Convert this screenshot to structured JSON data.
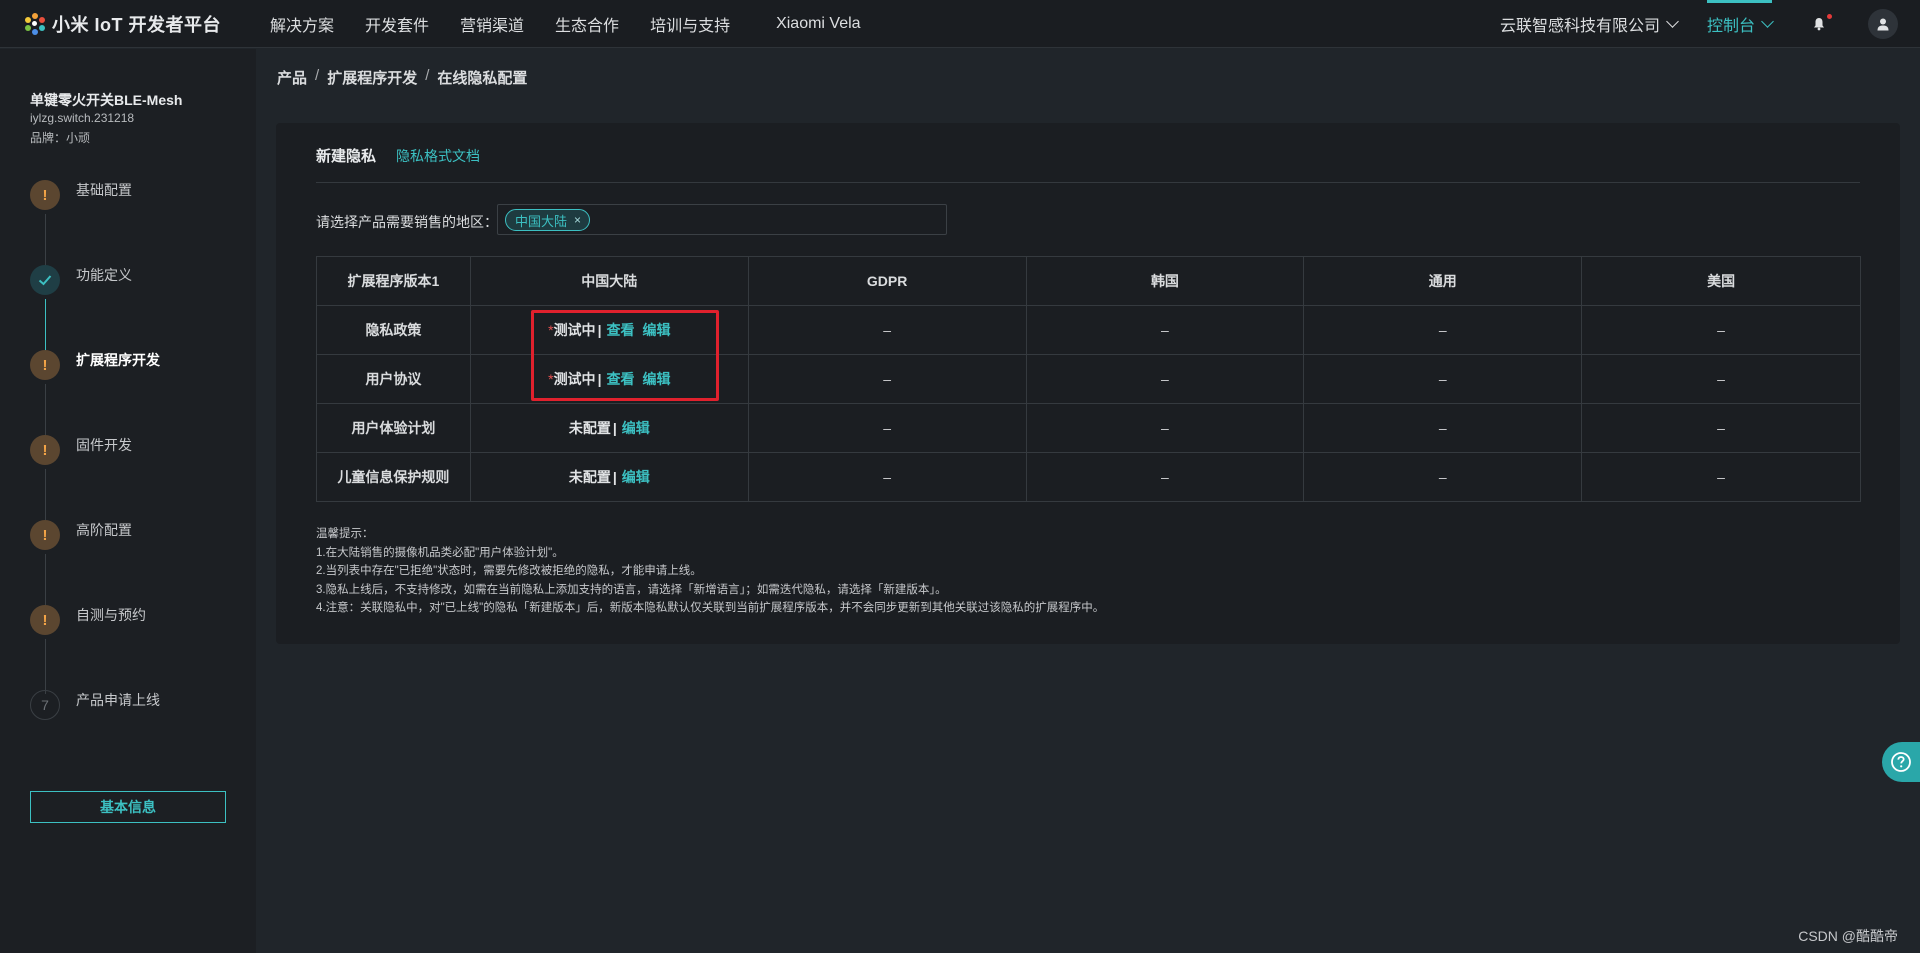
{
  "brand": {
    "logo_text": "小米 IoT 开发者平台"
  },
  "topnav": {
    "items": [
      "解决方案",
      "开发套件",
      "营销渠道",
      "生态合作",
      "培训与支持",
      "Xiaomi Vela"
    ],
    "company": "云联智感科技有限公司",
    "console": "控制台",
    "accent_color": "#3cc0c2"
  },
  "product": {
    "name": "单键零火开关BLE-Mesh",
    "model": "iylzg.switch.231218",
    "brand": "品牌：小顽"
  },
  "steps": [
    {
      "label": "基础配置",
      "state": "warning",
      "icon": "!"
    },
    {
      "label": "功能定义",
      "state": "done",
      "icon": "check-icon"
    },
    {
      "label": "扩展程序开发",
      "state": "active-warning",
      "icon": "!"
    },
    {
      "label": "固件开发",
      "state": "warning",
      "icon": "!"
    },
    {
      "label": "高阶配置",
      "state": "warning",
      "icon": "!"
    },
    {
      "label": "自测与预约",
      "state": "warning",
      "icon": "!"
    },
    {
      "label": "产品申请上线",
      "state": "pending",
      "icon": "7"
    }
  ],
  "sidebar": {
    "basic_info_button": "基本信息"
  },
  "breadcrumb": [
    "产品",
    "扩展程序开发",
    "在线隐私配置"
  ],
  "card": {
    "title": "新建隐私",
    "doc_link": "隐私格式文档",
    "region_label": "请选择产品需要销售的地区：",
    "region_tags": [
      {
        "label": "中国大陆",
        "close": "×"
      }
    ]
  },
  "table": {
    "headers": [
      "扩展程序版本1",
      "中国大陆",
      "GDPR",
      "韩国",
      "通用",
      "美国"
    ],
    "rows": [
      {
        "name": "隐私政策",
        "star": "*",
        "status": "测试中",
        "sep": "|",
        "actions": [
          "查看",
          "编辑"
        ],
        "others": [
          "–",
          "–",
          "–",
          "–"
        ]
      },
      {
        "name": "用户协议",
        "star": "*",
        "status": "测试中",
        "sep": "|",
        "actions": [
          "查看",
          "编辑"
        ],
        "others": [
          "–",
          "–",
          "–",
          "–"
        ]
      },
      {
        "name": "用户体验计划",
        "star": "",
        "status": "未配置",
        "sep": "|",
        "actions": [
          "编辑"
        ],
        "others": [
          "–",
          "–",
          "–",
          "–"
        ]
      },
      {
        "name": "儿童信息保护规则",
        "star": "",
        "status": "未配置",
        "sep": "|",
        "actions": [
          "编辑"
        ],
        "others": [
          "–",
          "–",
          "–",
          "–"
        ]
      }
    ]
  },
  "tips": {
    "title": "温馨提示：",
    "lines": [
      "1.在大陆销售的摄像机品类必配\"用户体验计划\"。",
      "2.当列表中存在\"已拒绝\"状态时，需要先修改被拒绝的隐私，才能申请上线。",
      "3.隐私上线后，不支持修改，如需在当前隐私上添加支持的语言，请选择「新增语言」；如需迭代隐私，请选择「新建版本」。",
      "4.注意：关联隐私中，对\"已上线\"的隐私「新建版本」后，新版本隐私默认仅关联到当前扩展程序版本，并不会同步更新到其他关联过该隐私的扩展程序中。"
    ]
  },
  "watermark": "CSDN @酷酷帝"
}
